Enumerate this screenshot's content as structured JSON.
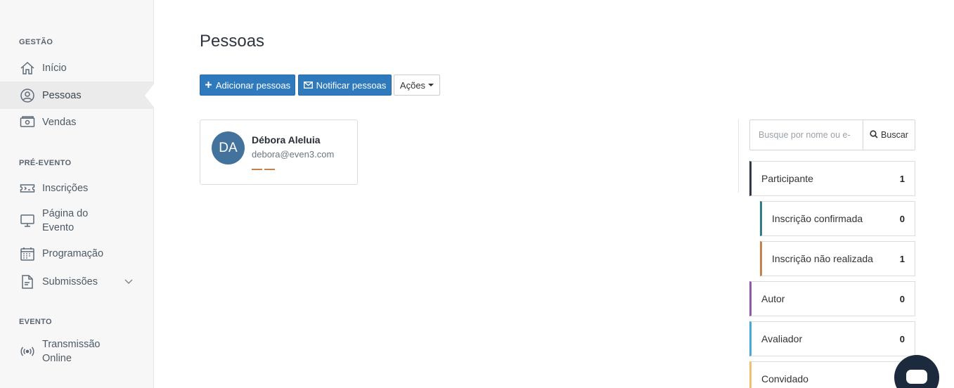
{
  "sidebar": {
    "sections": [
      {
        "title": "GESTÃO"
      },
      {
        "title": "PRÉ-EVENTO"
      },
      {
        "title": "EVENTO"
      }
    ],
    "items": [
      {
        "label": "Início",
        "icon": "home-icon"
      },
      {
        "label": "Pessoas",
        "icon": "user-circle-icon",
        "active": true
      },
      {
        "label": "Vendas",
        "icon": "cash-icon"
      },
      {
        "label": "Inscrições",
        "icon": "ticket-icon"
      },
      {
        "label_line1": "Página do",
        "label_line2": "Evento",
        "icon": "monitor-icon"
      },
      {
        "label": "Programação",
        "icon": "calendar-icon"
      },
      {
        "label": "Submissões",
        "icon": "document-icon",
        "chevron": "chevron-down-icon"
      },
      {
        "label_line1": "Transmissão",
        "label_line2": "Online",
        "icon": "broadcast-icon"
      }
    ]
  },
  "main": {
    "title": "Pessoas",
    "buttons": {
      "add": "Adicionar pessoas",
      "notify": "Notificar pessoas",
      "actions": "Ações"
    },
    "people": [
      {
        "initials": "DA",
        "name": "Débora Aleluia",
        "email": "debora@even3.com"
      }
    ]
  },
  "filters_panel": {
    "search": {
      "placeholder": "Busque por nome ou e-",
      "button": "Buscar"
    },
    "filters": [
      {
        "label": "Participante",
        "count": "1",
        "color": "#2f3a46"
      },
      {
        "label": "Inscrição confirmada",
        "count": "0",
        "color": "#2f7d8c"
      },
      {
        "label": "Inscrição não realizada",
        "count": "1",
        "color": "#c8814d"
      },
      {
        "label": "Autor",
        "count": "0",
        "color": "#8e5aa8"
      },
      {
        "label": "Avaliador",
        "count": "0",
        "color": "#4aa8d8"
      },
      {
        "label": "Convidado",
        "count": "",
        "color": "#f0c070"
      }
    ]
  },
  "colors": {
    "primary": "#2f79bd",
    "sidebar_bg": "#f7f7f7",
    "avatar_bg": "#43739c"
  }
}
